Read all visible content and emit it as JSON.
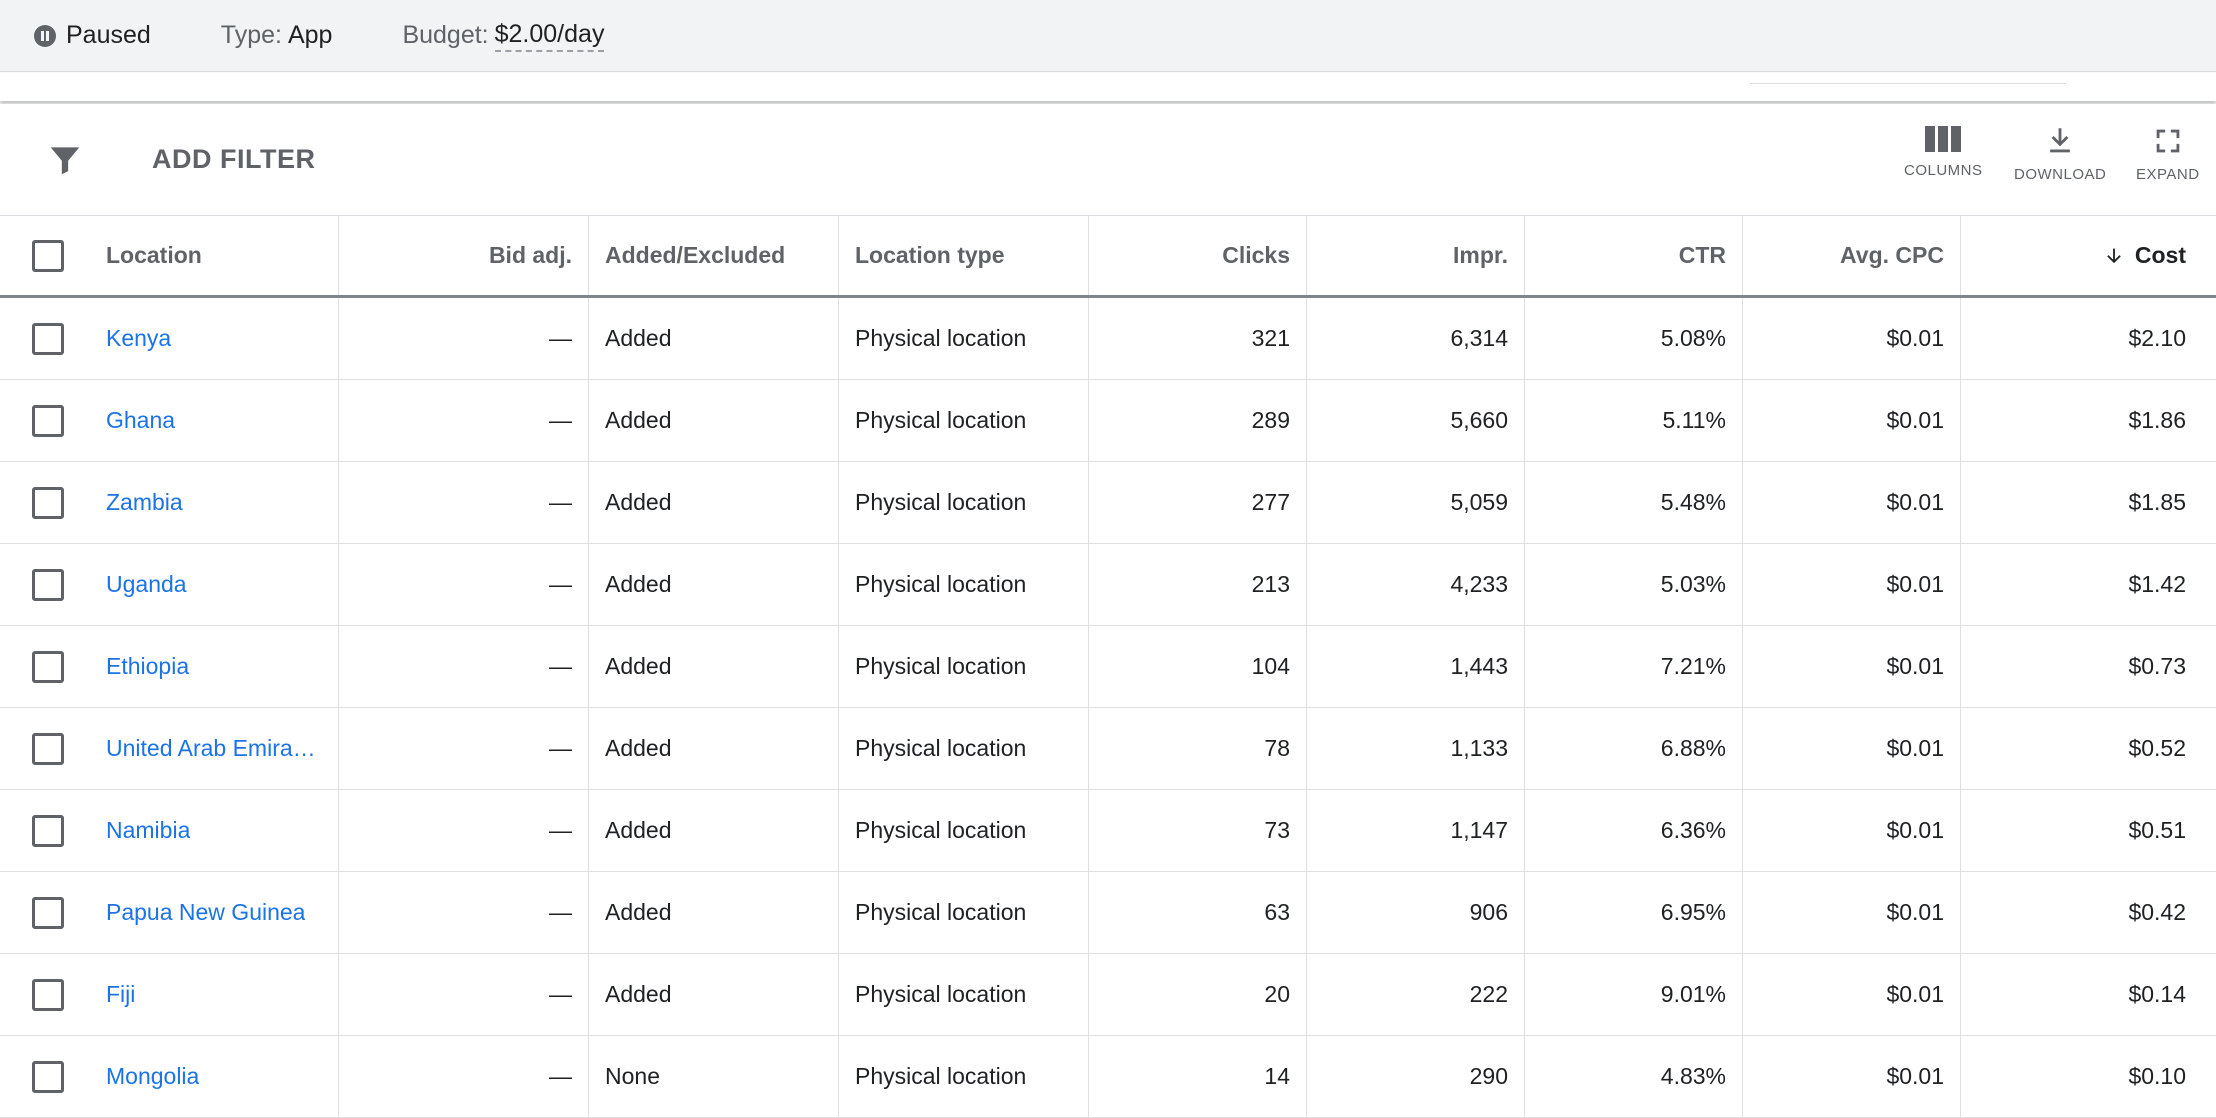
{
  "status_bar": {
    "status": "Paused",
    "type_label": "Type:",
    "type_value": "App",
    "budget_label": "Budget:",
    "budget_value": "$2.00/day"
  },
  "toolbar": {
    "add_filter_label": "ADD FILTER",
    "columns_label": "COLUMNS",
    "download_label": "DOWNLOAD",
    "expand_label": "EXPAND"
  },
  "table": {
    "headers": {
      "location": "Location",
      "bid_adj": "Bid adj.",
      "added_excluded": "Added/Excluded",
      "location_type": "Location type",
      "clicks": "Clicks",
      "impr": "Impr.",
      "ctr": "CTR",
      "avg_cpc": "Avg. CPC",
      "cost": "Cost"
    },
    "sort": {
      "column": "Cost",
      "direction": "descending"
    },
    "rows": [
      {
        "location": "Kenya",
        "bid_adj": "—",
        "added_excluded": "Added",
        "location_type": "Physical location",
        "clicks": "321",
        "impr": "6,314",
        "ctr": "5.08%",
        "avg_cpc": "$0.01",
        "cost": "$2.10"
      },
      {
        "location": "Ghana",
        "bid_adj": "—",
        "added_excluded": "Added",
        "location_type": "Physical location",
        "clicks": "289",
        "impr": "5,660",
        "ctr": "5.11%",
        "avg_cpc": "$0.01",
        "cost": "$1.86"
      },
      {
        "location": "Zambia",
        "bid_adj": "—",
        "added_excluded": "Added",
        "location_type": "Physical location",
        "clicks": "277",
        "impr": "5,059",
        "ctr": "5.48%",
        "avg_cpc": "$0.01",
        "cost": "$1.85"
      },
      {
        "location": "Uganda",
        "bid_adj": "—",
        "added_excluded": "Added",
        "location_type": "Physical location",
        "clicks": "213",
        "impr": "4,233",
        "ctr": "5.03%",
        "avg_cpc": "$0.01",
        "cost": "$1.42"
      },
      {
        "location": "Ethiopia",
        "bid_adj": "—",
        "added_excluded": "Added",
        "location_type": "Physical location",
        "clicks": "104",
        "impr": "1,443",
        "ctr": "7.21%",
        "avg_cpc": "$0.01",
        "cost": "$0.73"
      },
      {
        "location": "United Arab Emirat…",
        "bid_adj": "—",
        "added_excluded": "Added",
        "location_type": "Physical location",
        "clicks": "78",
        "impr": "1,133",
        "ctr": "6.88%",
        "avg_cpc": "$0.01",
        "cost": "$0.52"
      },
      {
        "location": "Namibia",
        "bid_adj": "—",
        "added_excluded": "Added",
        "location_type": "Physical location",
        "clicks": "73",
        "impr": "1,147",
        "ctr": "6.36%",
        "avg_cpc": "$0.01",
        "cost": "$0.51"
      },
      {
        "location": "Papua New Guinea",
        "bid_adj": "—",
        "added_excluded": "Added",
        "location_type": "Physical location",
        "clicks": "63",
        "impr": "906",
        "ctr": "6.95%",
        "avg_cpc": "$0.01",
        "cost": "$0.42"
      },
      {
        "location": "Fiji",
        "bid_adj": "—",
        "added_excluded": "Added",
        "location_type": "Physical location",
        "clicks": "20",
        "impr": "222",
        "ctr": "9.01%",
        "avg_cpc": "$0.01",
        "cost": "$0.14"
      },
      {
        "location": "Mongolia",
        "bid_adj": "—",
        "added_excluded": "None",
        "location_type": "Physical location",
        "clicks": "14",
        "impr": "290",
        "ctr": "4.83%",
        "avg_cpc": "$0.01",
        "cost": "$0.10"
      }
    ]
  },
  "colors": {
    "link": "#1a73e8",
    "header_text": "#5f6368",
    "status_bg": "#f1f3f4"
  }
}
